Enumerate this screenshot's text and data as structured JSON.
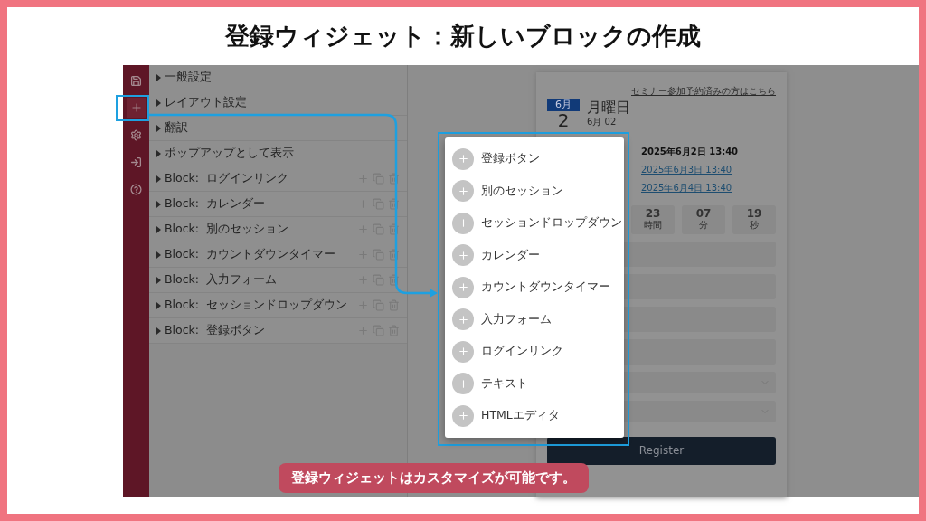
{
  "title": "登録ウィジェット：新しいブロックの作成",
  "caption": "登録ウィジェットはカスタマイズが可能です。",
  "sidebar": {
    "items": [
      {
        "kind": "save",
        "selected": false
      },
      {
        "kind": "add",
        "selected": true
      },
      {
        "kind": "settings",
        "selected": false
      },
      {
        "kind": "login",
        "selected": false
      },
      {
        "kind": "help",
        "selected": false
      }
    ]
  },
  "panel": {
    "rows": [
      {
        "label": "一般設定",
        "kind": "section"
      },
      {
        "label": "レイアウト設定",
        "kind": "section"
      },
      {
        "label": "翻訳",
        "kind": "section"
      },
      {
        "label": "ポップアップとして表示",
        "kind": "section"
      },
      {
        "label": "Block:  ログインリンク",
        "kind": "block"
      },
      {
        "label": "Block:  カレンダー",
        "kind": "block"
      },
      {
        "label": "Block:  別のセッション",
        "kind": "block"
      },
      {
        "label": "Block:  カウントダウンタイマー",
        "kind": "block"
      },
      {
        "label": "Block:  入力フォーム",
        "kind": "block"
      },
      {
        "label": "Block:  セッションドロップダウン",
        "kind": "block"
      },
      {
        "label": "Block:  登録ボタン",
        "kind": "block"
      }
    ]
  },
  "popup": {
    "items": [
      "登録ボタン",
      "別のセッション",
      "セッションドロップダウン",
      "カレンダー",
      "カウントダウンタイマー",
      "入力フォーム",
      "ログインリンク",
      "テキスト",
      "HTMLエディタ"
    ]
  },
  "preview": {
    "link": "セミナー参加予約済みの方はこちら",
    "month": "6月",
    "weekday": "月曜日",
    "day": "2",
    "date_short": "6月 02",
    "dates": [
      {
        "text": "2025年6月2日 13:40",
        "selected": true
      },
      {
        "text": "2025年6月3日 13:40",
        "selected": false
      },
      {
        "text": "2025年6月4日 13:40",
        "selected": false
      }
    ],
    "countdown": [
      {
        "value": "23",
        "unit": "時間"
      },
      {
        "value": "07",
        "unit": "分"
      },
      {
        "value": "19",
        "unit": "秒"
      }
    ],
    "fields": [
      {
        "kind": "text"
      },
      {
        "kind": "text"
      },
      {
        "kind": "text"
      },
      {
        "kind": "text"
      },
      {
        "kind": "select"
      },
      {
        "kind": "select"
      }
    ],
    "register_button": "Register"
  }
}
